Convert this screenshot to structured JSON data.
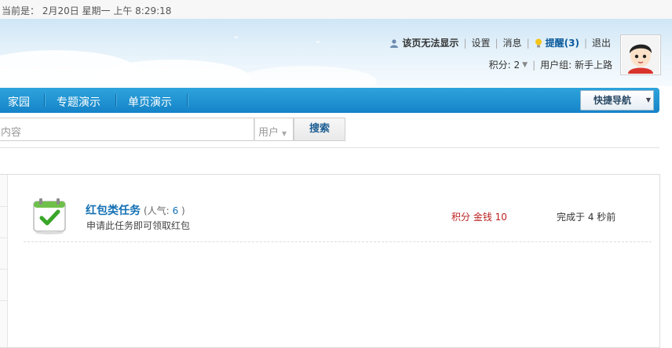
{
  "topbar": {
    "time_text": "当前是： 2月20日 星期一 上午 8:29:18"
  },
  "user": {
    "display_name": "该页无法显示",
    "settings": "设置",
    "messages": "消息",
    "notice": "提醒(3)",
    "logout": "退出",
    "credits_label": "积分: 2",
    "group_label": "用户组: 新手上路"
  },
  "nav": {
    "items": [
      "家园",
      "专题演示",
      "单页演示"
    ],
    "quick_nav": "快捷导航"
  },
  "search": {
    "input_text": "内容",
    "type_value": "用户",
    "button": "搜索"
  },
  "task": {
    "title": "红包类任务",
    "popularity_label": "(人气:",
    "popularity_value": "6",
    "popularity_close": ")",
    "description": "申请此任务即可领取红包",
    "reward": "积分 金钱 10",
    "status": "完成于 4 秒前"
  },
  "colors": {
    "nav_bg": "#1a8fd2",
    "link_blue": "#1470b4",
    "reward_red": "#b22222"
  }
}
